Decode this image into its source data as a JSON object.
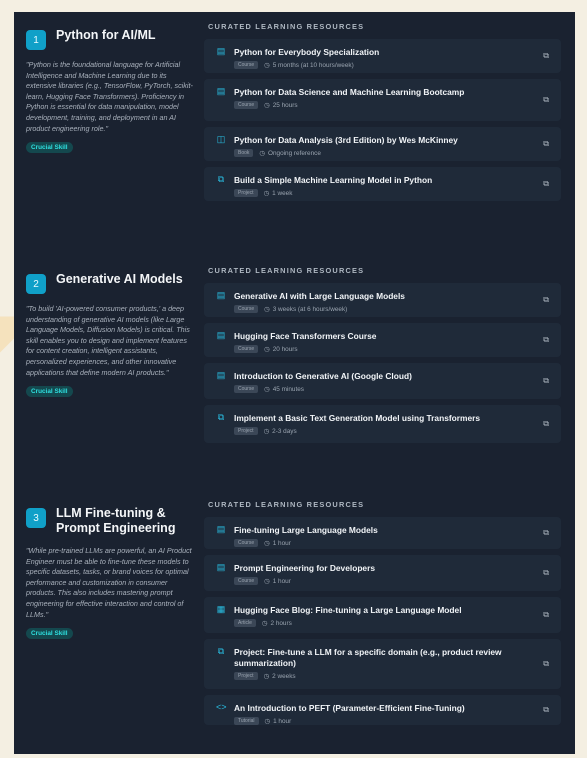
{
  "sections": [
    {
      "num": "1",
      "title": "Python for AI/ML",
      "desc": "\"Python is the foundational language for Artificial Intelligence and Machine Learning due to its extensive libraries (e.g., TensorFlow, PyTorch, scikit-learn, Hugging Face Transformers). Proficiency in Python is essential for data manipulation, model development, training, and deployment in an AI product engineering role.\"",
      "skill": "Crucial Skill",
      "heading": "CURATED LEARNING RESOURCES",
      "resources": [
        {
          "icon": "course-icon",
          "glyph": "▤",
          "title": "Python for Everybody Specialization",
          "type": "Course",
          "time": "5 months (at 10 hours/week)"
        },
        {
          "icon": "course-icon",
          "glyph": "▤",
          "title": "Python for Data Science and Machine Learning Bootcamp",
          "type": "Course",
          "time": "25 hours"
        },
        {
          "icon": "book-icon",
          "glyph": "◫",
          "title": "Python for Data Analysis (3rd Edition) by Wes McKinney",
          "type": "Book",
          "time": "Ongoing reference"
        },
        {
          "icon": "project-icon",
          "glyph": "⧉",
          "title": "Build a Simple Machine Learning Model in Python",
          "type": "Project",
          "time": "1 week"
        }
      ]
    },
    {
      "num": "2",
      "title": "Generative AI Models",
      "desc": "\"To build 'AI-powered consumer products,' a deep understanding of generative AI models (like Large Language Models, Diffusion Models) is critical. This skill enables you to design and implement features for content creation, intelligent assistants, personalized experiences, and other innovative applications that define modern AI products.\"",
      "skill": "Crucial Skill",
      "heading": "CURATED LEARNING RESOURCES",
      "resources": [
        {
          "icon": "course-icon",
          "glyph": "▤",
          "title": "Generative AI with Large Language Models",
          "type": "Course",
          "time": "3 weeks (at 6 hours/week)"
        },
        {
          "icon": "course-icon",
          "glyph": "▤",
          "title": "Hugging Face Transformers Course",
          "type": "Course",
          "time": "20 hours"
        },
        {
          "icon": "course-icon",
          "glyph": "▤",
          "title": "Introduction to Generative AI (Google Cloud)",
          "type": "Course",
          "time": "45 minutes"
        },
        {
          "icon": "project-icon",
          "glyph": "⧉",
          "title": "Implement a Basic Text Generation Model using Transformers",
          "type": "Project",
          "time": "2-3 days"
        }
      ]
    },
    {
      "num": "3",
      "title": "LLM Fine-tuning & Prompt Engineering",
      "desc": "\"While pre-trained LLMs are powerful, an AI Product Engineer must be able to fine-tune these models to specific datasets, tasks, or brand voices for optimal performance and customization in consumer products. This also includes mastering prompt engineering for effective interaction and control of LLMs.\"",
      "skill": "Crucial Skill",
      "heading": "CURATED LEARNING RESOURCES",
      "resources": [
        {
          "icon": "course-icon",
          "glyph": "▤",
          "title": "Fine-tuning Large Language Models",
          "type": "Course",
          "time": "1 hour"
        },
        {
          "icon": "course-icon",
          "glyph": "▤",
          "title": "Prompt Engineering for Developers",
          "type": "Course",
          "time": "1 hour"
        },
        {
          "icon": "article-icon",
          "glyph": "▦",
          "title": "Hugging Face Blog: Fine-tuning a Large Language Model",
          "type": "Article",
          "time": "2 hours"
        },
        {
          "icon": "project-icon",
          "glyph": "⧉",
          "title": "Project: Fine-tune a LLM for a specific domain (e.g., product review summarization)",
          "type": "Project",
          "time": "2 weeks"
        },
        {
          "icon": "tutorial-icon",
          "glyph": "<>",
          "title": "An Introduction to PEFT (Parameter-Efficient Fine-Tuning)",
          "type": "Tutorial",
          "time": "1 hour"
        }
      ]
    }
  ]
}
